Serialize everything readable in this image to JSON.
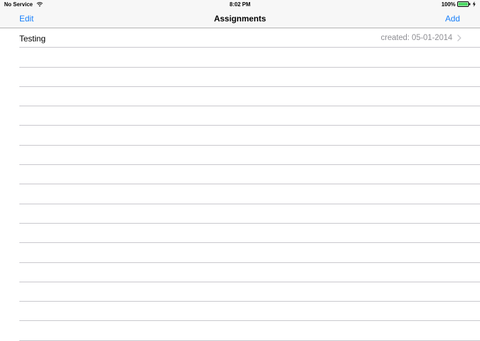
{
  "status_bar": {
    "carrier": "No Service",
    "time": "8:02 PM",
    "battery": "100%"
  },
  "nav_bar": {
    "title": "Assignments",
    "edit_label": "Edit",
    "add_label": "Add"
  },
  "table": {
    "rows": [
      {
        "title": "Testing",
        "detail": "created: 05-01-2014"
      }
    ],
    "empty_rows": 15
  },
  "colors": {
    "accent": "#157efb",
    "separator": "#c8c7cc",
    "detail_text": "#8e8e93",
    "bar_background": "#f7f7f7",
    "battery": "#4cd964"
  },
  "icons": {
    "wifi": "wifi-icon",
    "battery": "battery-icon",
    "charging": "charging-bolt-icon",
    "disclosure": "chevron-right-icon"
  }
}
